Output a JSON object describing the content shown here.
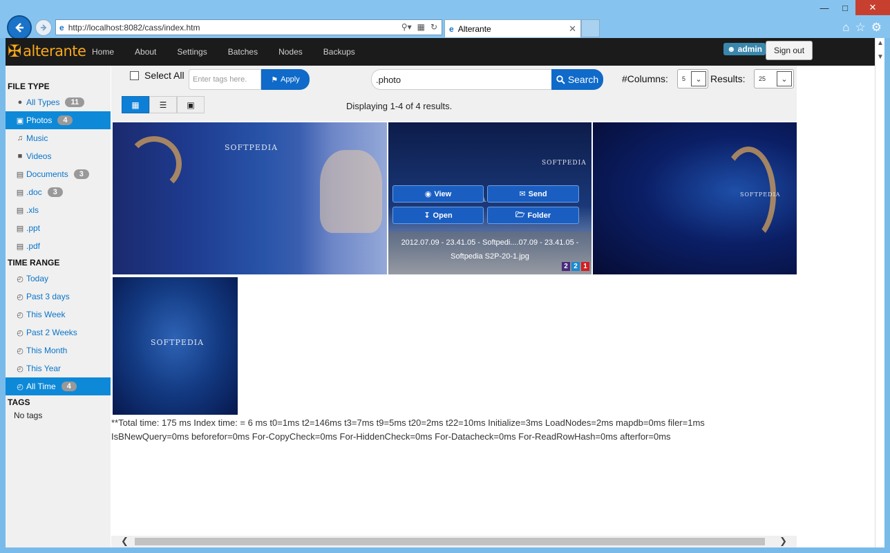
{
  "browser": {
    "url": "http://localhost:8082/cass/index.htm",
    "tab_title": "Alterante"
  },
  "app": {
    "logo_text": "alterante",
    "nav": [
      "Home",
      "About",
      "Settings",
      "Batches",
      "Nodes",
      "Backups"
    ],
    "user": "admin",
    "signout_label": "Sign out"
  },
  "sidebar": {
    "file_type_heading": "FILE TYPE",
    "file_types": [
      {
        "label": "All Types",
        "count": "11",
        "icon": "globe-icon"
      },
      {
        "label": "Photos",
        "count": "4",
        "icon": "camera-icon",
        "active": true
      },
      {
        "label": "Music",
        "count": "",
        "icon": "music-icon"
      },
      {
        "label": "Videos",
        "count": "",
        "icon": "video-icon"
      },
      {
        "label": "Documents",
        "count": "3",
        "icon": "briefcase-icon"
      },
      {
        "label": ".doc",
        "count": "3",
        "icon": "briefcase-icon"
      },
      {
        "label": ".xls",
        "count": "",
        "icon": "briefcase-icon"
      },
      {
        "label": ".ppt",
        "count": "",
        "icon": "briefcase-icon"
      },
      {
        "label": ".pdf",
        "count": "",
        "icon": "briefcase-icon"
      }
    ],
    "time_range_heading": "TIME RANGE",
    "time_ranges": [
      {
        "label": "Today",
        "count": ""
      },
      {
        "label": "Past 3 days",
        "count": ""
      },
      {
        "label": "This Week",
        "count": ""
      },
      {
        "label": "Past 2 Weeks",
        "count": ""
      },
      {
        "label": "This Month",
        "count": ""
      },
      {
        "label": "This Year",
        "count": ""
      },
      {
        "label": "All Time",
        "count": "4",
        "active": true
      }
    ],
    "tags_heading": "TAGS",
    "no_tags": "No tags"
  },
  "toolbar": {
    "select_all": "Select All",
    "tags_placeholder": "Enter tags here.",
    "apply_label": "Apply",
    "search_value": ".photo",
    "search_label": "Search",
    "columns_label": "#Columns:",
    "columns_value": "5",
    "results_label": "Results:",
    "results_value": "25",
    "display_text": "Displaying 1-4 of 4 results."
  },
  "grid": {
    "tile_watermark": "SOFTPEDIA",
    "hover_tile": {
      "watermark": "SOFTPEDIA",
      "actions": {
        "view": "View",
        "send": "Send",
        "open": "Open",
        "folder": "Folder"
      },
      "caption_line1": "2012.07.09 - 23.41.05 - Softpedi....07.09 - 23.41.05 -",
      "caption_line2": "Softpedia S2P-20-1.jpg",
      "ratings": [
        "2",
        "2",
        "1"
      ],
      "rating_colors": [
        "#4a2a7a",
        "#1a8ad0",
        "#d21f1f"
      ]
    }
  },
  "timing": {
    "line1": "**Total time: 175 ms Index time: = 6 ms t0=1ms t2=146ms t3=7ms t9=5ms t20=2ms t22=10ms Initialize=3ms LoadNodes=2ms mapdb=0ms filer=1ms",
    "line2": "IsBNewQuery=0ms beforefor=0ms For-CopyCheck=0ms For-HiddenCheck=0ms For-Datacheck=0ms For-ReadRowHash=0ms afterfor=0ms"
  }
}
